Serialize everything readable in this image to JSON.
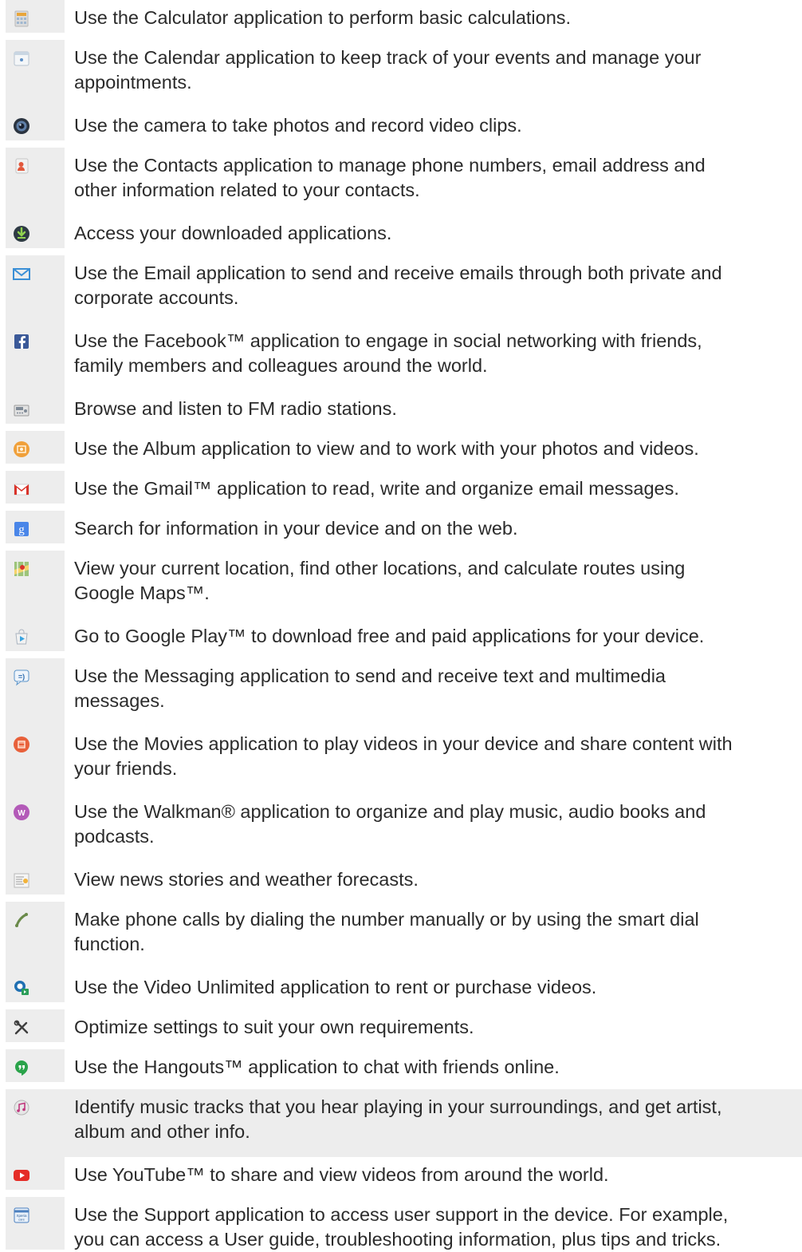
{
  "apps": [
    {
      "icon": "calculator-icon",
      "text": "Use the Calculator application to perform basic calculations."
    },
    {
      "icon": "calendar-icon",
      "text": "Use the Calendar application to keep track of your events and manage your\nappointments."
    },
    {
      "icon": "camera-icon",
      "text": "Use the camera to take photos and record video clips."
    },
    {
      "icon": "contacts-icon",
      "text": "Use the Contacts application to manage phone numbers, email address and\nother information related to your contacts."
    },
    {
      "icon": "download-icon",
      "text": "Access your downloaded applications."
    },
    {
      "icon": "email-icon",
      "text": "Use the Email application to send and receive emails through both private and\ncorporate accounts."
    },
    {
      "icon": "facebook-icon",
      "text": "Use the Facebook™ application to engage in social networking with friends,\nfamily members and colleagues around the world."
    },
    {
      "icon": "fm-radio-icon",
      "text": "Browse and listen to FM radio stations."
    },
    {
      "icon": "album-icon",
      "text": "Use the Album application to view and to work with your photos and videos."
    },
    {
      "icon": "gmail-icon",
      "text": "Use the Gmail™ application to read, write and organize email messages."
    },
    {
      "icon": "google-search-icon",
      "text": "Search for information in your device and on the web."
    },
    {
      "icon": "maps-icon",
      "text": "View your current location, find other locations, and calculate routes using\nGoogle Maps™."
    },
    {
      "icon": "play-store-icon",
      "text": "Go to Google Play™ to download free and paid applications for your device."
    },
    {
      "icon": "messaging-icon",
      "text": "Use the Messaging application to send and receive text and multimedia\nmessages."
    },
    {
      "icon": "movies-icon",
      "text": "Use the Movies application to play videos in your device and share content with\nyour friends."
    },
    {
      "icon": "walkman-icon",
      "text": "Use the Walkman® application to organize and play music, audio books and\npodcasts."
    },
    {
      "icon": "news-weather-icon",
      "text": "View news stories and weather forecasts."
    },
    {
      "icon": "phone-icon",
      "text": "Make phone calls by dialing the number manually or by using the smart dial\nfunction."
    },
    {
      "icon": "video-unlimited-icon",
      "text": "Use the Video Unlimited application to rent or purchase videos."
    },
    {
      "icon": "settings-icon",
      "text": "Optimize settings to suit your own requirements."
    },
    {
      "icon": "hangouts-icon",
      "text": "Use the Hangouts™ application to chat with friends online."
    },
    {
      "icon": "trackid-icon",
      "text": "Identify music tracks that you hear playing in your surroundings, and get artist,\nalbum and other info.",
      "highlighted": true
    },
    {
      "icon": "youtube-icon",
      "text": "Use YouTube™ to share and view videos from around the world."
    },
    {
      "icon": "support-icon",
      "text": "Use the Support application to access user support in the device. For example,\nyou can access a User guide, troubleshooting information, plus tips and tricks."
    }
  ],
  "colors": {
    "row_background": "#ededed",
    "text": "#2b2b2b"
  }
}
